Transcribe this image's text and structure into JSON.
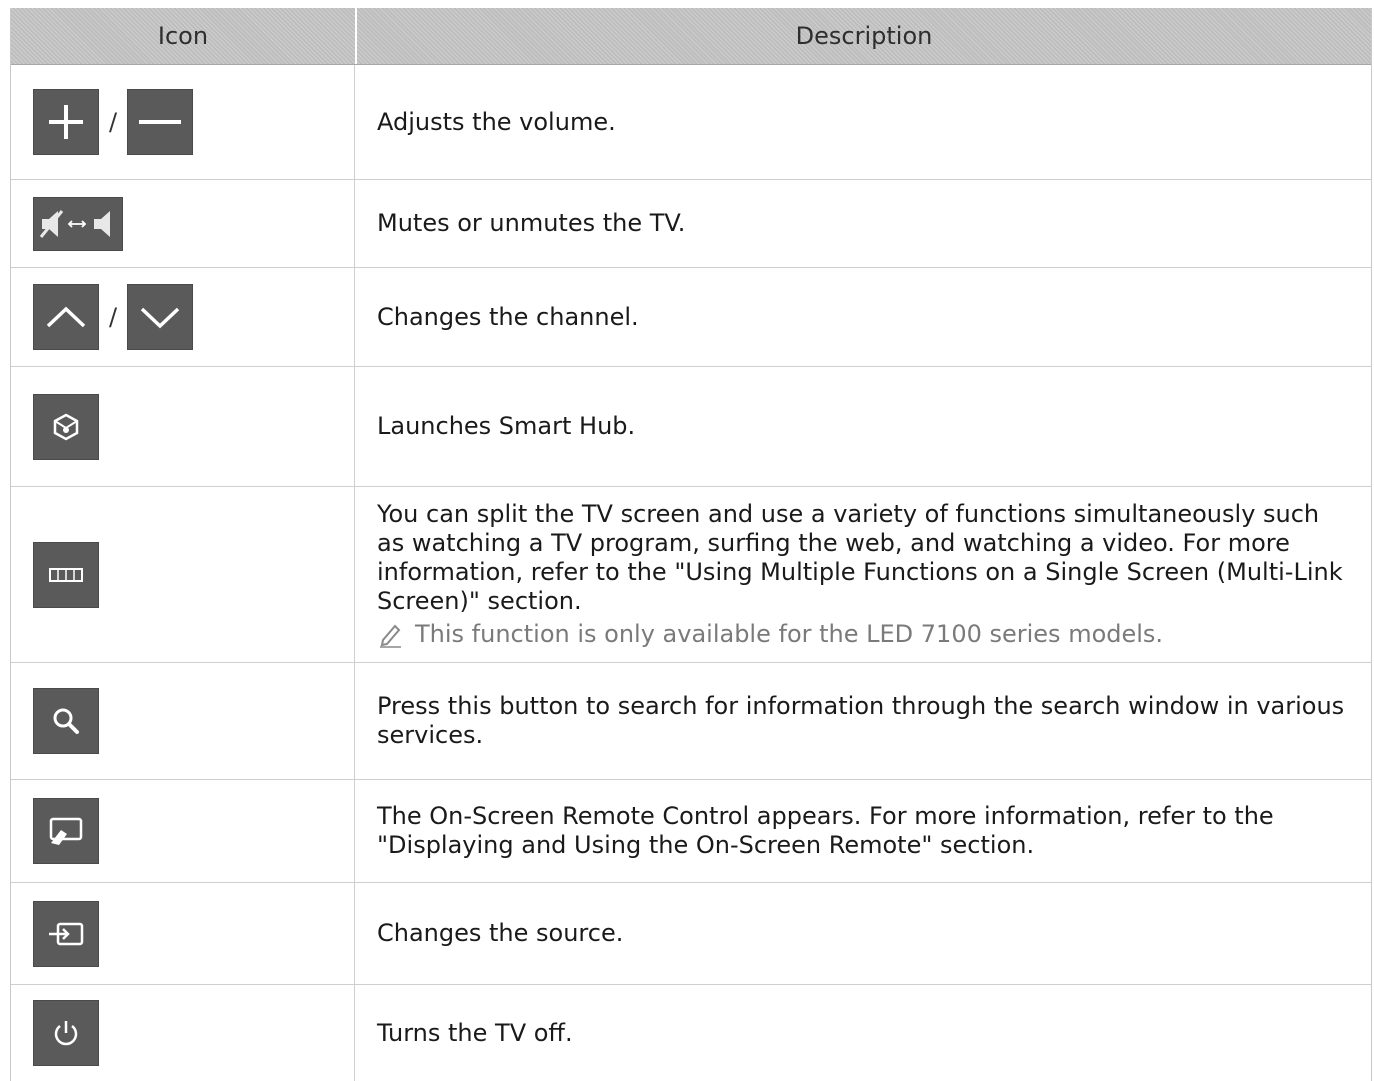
{
  "table": {
    "headers": {
      "icon": "Icon",
      "description": "Description"
    },
    "rows": [
      {
        "description": "Adjusts the volume.",
        "separator": "/"
      },
      {
        "description": "Mutes or unmutes the TV."
      },
      {
        "description": "Changes the channel.",
        "separator": "/"
      },
      {
        "description": "Launches Smart Hub."
      },
      {
        "description": "You can split the TV screen and use a variety of functions simultaneously such as watching a TV program, surfing the web, and watching a video. For more information, refer to the \"Using Multiple Functions on a Single Screen (Multi-Link Screen)\" section.",
        "note": "This function is only available for the LED 7100 series models."
      },
      {
        "description": "Press this button to search for information through the search window in various services."
      },
      {
        "description": "The On-Screen Remote Control appears. For more information, refer to the \"Displaying and Using the On-Screen Remote\" section."
      },
      {
        "description": "Changes the source."
      },
      {
        "description": "Turns the TV off."
      }
    ]
  },
  "colors": {
    "icon_bg": "#5a5a5a",
    "header_bg": "#bdbdbd",
    "note_text": "#7a7a7a"
  }
}
